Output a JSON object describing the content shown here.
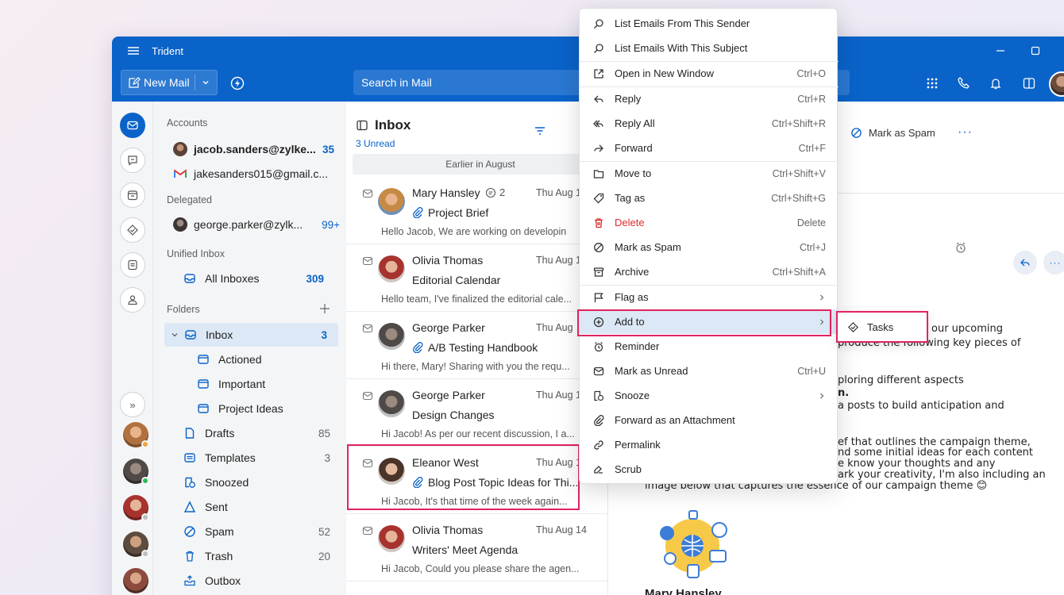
{
  "window": {
    "title": "Trident"
  },
  "toolbar": {
    "new_mail": "New Mail",
    "search_placeholder": "Search in Mail"
  },
  "rail": {
    "expand_label": "»"
  },
  "folders": {
    "accounts_heading": "Accounts",
    "accounts": [
      {
        "name": "jacob.sanders@zylke...",
        "count": "35"
      },
      {
        "name": "jakesanders015@gmail.c...",
        "count": ""
      }
    ],
    "delegated_heading": "Delegated",
    "delegated": [
      {
        "name": "george.parker@zylk...",
        "count": "99+"
      }
    ],
    "unified_heading": "Unified Inbox",
    "all_inboxes": {
      "name": "All Inboxes",
      "count": "309"
    },
    "folders_heading": "Folders",
    "items": [
      {
        "name": "Inbox",
        "count": "3"
      },
      {
        "name": "Actioned",
        "count": ""
      },
      {
        "name": "Important",
        "count": ""
      },
      {
        "name": "Project Ideas",
        "count": ""
      },
      {
        "name": "Drafts",
        "count": "85"
      },
      {
        "name": "Templates",
        "count": "3"
      },
      {
        "name": "Snoozed",
        "count": ""
      },
      {
        "name": "Sent",
        "count": ""
      },
      {
        "name": "Spam",
        "count": "52"
      },
      {
        "name": "Trash",
        "count": "20"
      },
      {
        "name": "Outbox",
        "count": ""
      }
    ]
  },
  "list": {
    "title": "Inbox",
    "unread": "3 Unread",
    "group": "Earlier in August",
    "messages": [
      {
        "sender": "Mary Hansley",
        "thread": "2",
        "date": "Thu Aug 1",
        "subject": "Project Brief",
        "preview": "Hello Jacob, We are working on developin"
      },
      {
        "sender": "Olivia Thomas",
        "date": "Thu Aug 1",
        "subject": "Editorial Calendar",
        "preview": "Hello team, I've finalized the editorial cale..."
      },
      {
        "sender": "George Parker",
        "date": "Thu Aug",
        "subject": "A/B Testing Handbook",
        "preview": "Hi there, Mary! Sharing with you the requ..."
      },
      {
        "sender": "George Parker",
        "date": "Thu Aug 1",
        "subject": "Design Changes",
        "preview": "Hi Jacob! As per our recent discussion, I a..."
      },
      {
        "sender": "Eleanor West",
        "date": "Thu Aug 1",
        "subject": "Blog Post Topic Ideas for Thi...",
        "preview": "Hi Jacob, It's that time of the week again..."
      },
      {
        "sender": "Olivia Thomas",
        "date": "Thu Aug 14",
        "subject": "Writers' Meet Agenda",
        "preview": "Hi Jacob, Could you please share the agen..."
      }
    ]
  },
  "reading": {
    "mark_spam": "Mark as Spam",
    "more": "···",
    "lines": [
      "our upcoming",
      "produce the following key pieces of",
      "ploring different aspects",
      "n.",
      "a posts to build anticipation and",
      "ef that outlines the campaign theme,",
      "nd some initial ideas for each content",
      "e know your thoughts and any",
      "ark your creativity, I'm also including an",
      "image below that captures the essence of our campaign theme 😊"
    ],
    "sender_name": "Mary Hansley"
  },
  "context_menu": {
    "items": [
      {
        "label": "List Emails From This Sender",
        "shortcut": "",
        "icon": "search-icon"
      },
      {
        "label": "List Emails With This Subject",
        "shortcut": "",
        "icon": "search-icon"
      },
      {
        "label": "Open in New Window",
        "shortcut": "Ctrl+O",
        "icon": "open-window-icon"
      },
      {
        "label": "Reply",
        "shortcut": "Ctrl+R",
        "icon": "reply-icon"
      },
      {
        "label": "Reply All",
        "shortcut": "Ctrl+Shift+R",
        "icon": "reply-all-icon"
      },
      {
        "label": "Forward",
        "shortcut": "Ctrl+F",
        "icon": "forward-icon"
      },
      {
        "label": "Move to",
        "shortcut": "Ctrl+Shift+V",
        "icon": "folder-icon"
      },
      {
        "label": "Tag as",
        "shortcut": "Ctrl+Shift+G",
        "icon": "tag-icon"
      },
      {
        "label": "Delete",
        "shortcut": "Delete",
        "icon": "trash-icon"
      },
      {
        "label": "Mark as Spam",
        "shortcut": "Ctrl+J",
        "icon": "spam-icon"
      },
      {
        "label": "Archive",
        "shortcut": "Ctrl+Shift+A",
        "icon": "archive-icon"
      },
      {
        "label": "Flag as",
        "shortcut": "",
        "icon": "flag-icon"
      },
      {
        "label": "Add to",
        "shortcut": "",
        "icon": "add-circle-icon"
      },
      {
        "label": "Reminder",
        "shortcut": "",
        "icon": "alarm-icon"
      },
      {
        "label": "Mark as Unread",
        "shortcut": "Ctrl+U",
        "icon": "envelope-icon"
      },
      {
        "label": "Snooze",
        "shortcut": "",
        "icon": "snooze-icon"
      },
      {
        "label": "Forward as an Attachment",
        "shortcut": "",
        "icon": "paperclip-icon"
      },
      {
        "label": "Permalink",
        "shortcut": "",
        "icon": "link-icon"
      },
      {
        "label": "Scrub",
        "shortcut": "",
        "icon": "scrub-icon"
      }
    ],
    "submenu": {
      "label": "Tasks"
    }
  },
  "colors": {
    "brand": "#0a63c9",
    "highlight": "#e0245e",
    "danger": "#d92c2c"
  }
}
